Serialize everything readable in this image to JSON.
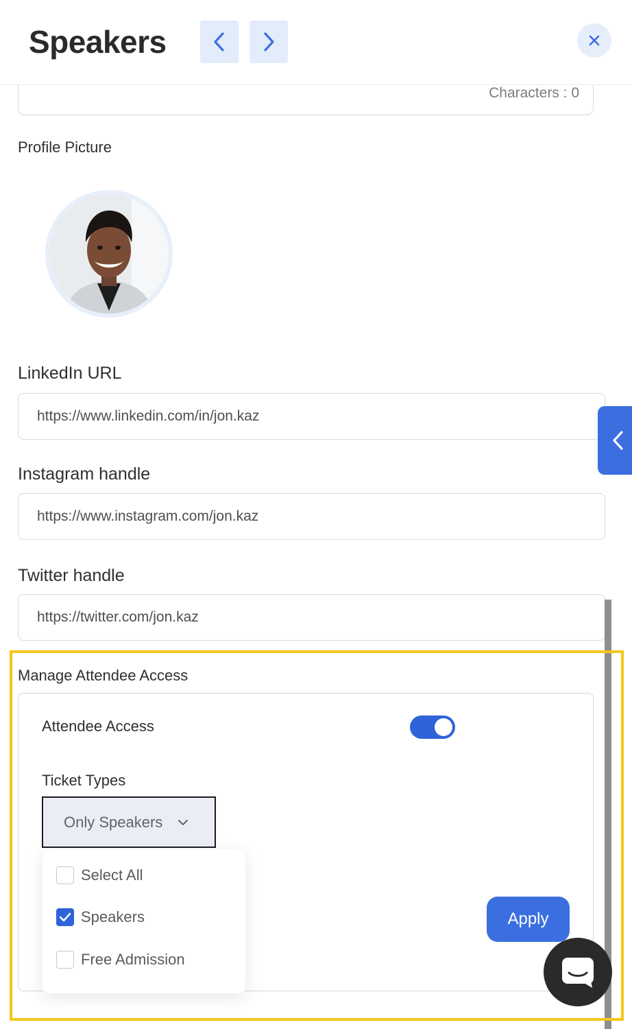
{
  "header": {
    "title": "Speakers",
    "prev_icon": "chevron-left-icon",
    "next_icon": "chevron-right-icon",
    "close_icon": "close-icon"
  },
  "bio": {
    "characters_label": "Characters : 0"
  },
  "profile": {
    "label": "Profile Picture"
  },
  "fields": {
    "linkedin": {
      "label": "LinkedIn URL",
      "value": "https://www.linkedin.com/in/jon.kaz"
    },
    "instagram": {
      "label": "Instagram handle",
      "value": "https://www.instagram.com/jon.kaz"
    },
    "twitter": {
      "label": "Twitter handle",
      "value": "https://twitter.com/jon.kaz"
    }
  },
  "access": {
    "section_label": "Manage Attendee Access",
    "toggle_label": "Attendee Access",
    "toggle_on": true,
    "ticket_label": "Ticket Types",
    "selected": "Only Speakers",
    "options": [
      {
        "label": "Select All",
        "checked": false
      },
      {
        "label": "Speakers",
        "checked": true
      },
      {
        "label": "Free Admission",
        "checked": false
      }
    ],
    "apply_label": "Apply"
  },
  "colors": {
    "accent": "#3b6fe0",
    "highlight": "#f5c61a"
  }
}
